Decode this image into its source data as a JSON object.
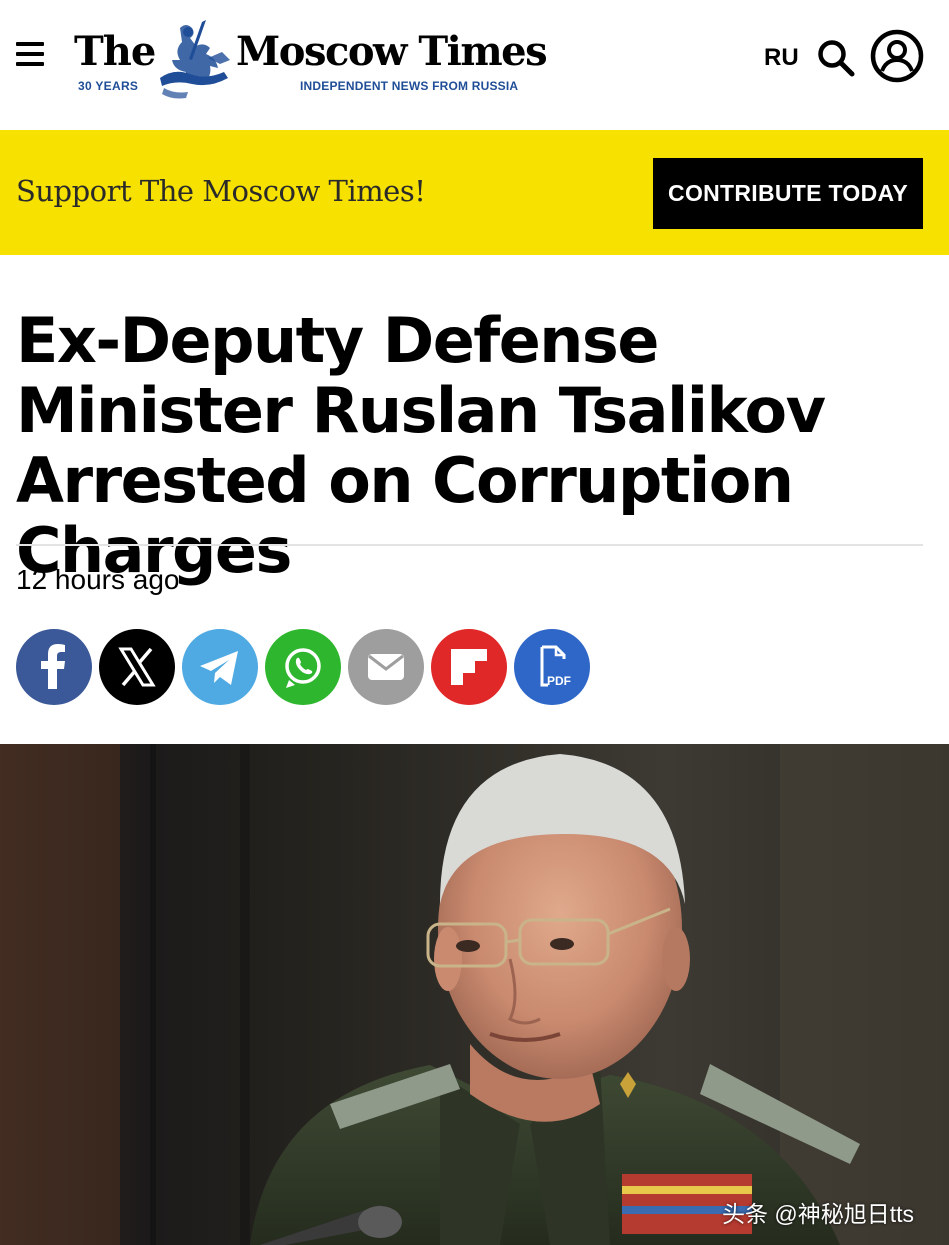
{
  "header": {
    "logo": {
      "the": "The",
      "name": "Moscow Times",
      "years": "30 YEARS",
      "tagline": "INDEPENDENT NEWS FROM RUSSIA"
    },
    "lang_label": "RU",
    "icons": [
      "menu-icon",
      "search-icon",
      "user-account-icon"
    ]
  },
  "banner": {
    "text": "Support The Moscow Times!",
    "button_label": "CONTRIBUTE TODAY",
    "background": "#f7e100"
  },
  "article": {
    "headline": "Ex-Deputy Defense Minister Ruslan Tsalikov Arrested on Corruption Charges",
    "time": "12 hours ago"
  },
  "share_buttons": [
    {
      "name": "facebook",
      "icon": "facebook-icon",
      "color": "#3b5998"
    },
    {
      "name": "x",
      "icon": "x-icon",
      "color": "#000000"
    },
    {
      "name": "telegram",
      "icon": "telegram-icon",
      "color": "#4fa9e2"
    },
    {
      "name": "whatsapp",
      "icon": "whatsapp-icon",
      "color": "#2fb62f"
    },
    {
      "name": "email",
      "icon": "email-icon",
      "color": "#9e9e9e"
    },
    {
      "name": "flipboard",
      "icon": "flipboard-icon",
      "color": "#e12828"
    },
    {
      "name": "pdf",
      "icon": "pdf-icon",
      "color": "#2f67c8",
      "label": "PDF"
    }
  ],
  "photo": {
    "watermark": "头条 @神秘旭日tts"
  }
}
